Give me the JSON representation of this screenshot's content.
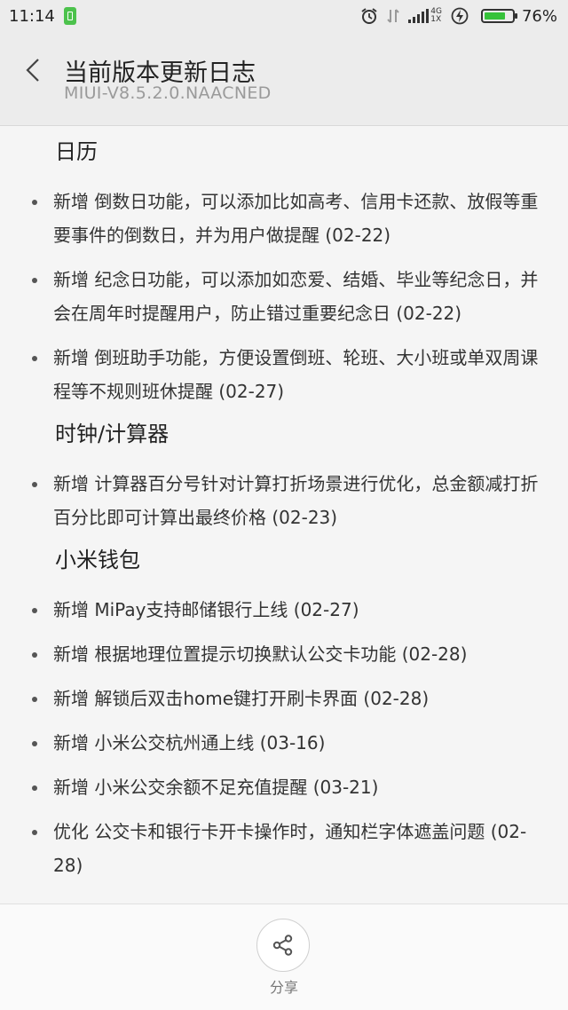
{
  "status_bar": {
    "time": "11:14",
    "net_gen": "4G",
    "net_sim": "1X",
    "battery_percent": 76,
    "battery_text": "76%",
    "accent_battery": "#36c23a"
  },
  "header": {
    "title": "当前版本更新日志",
    "subtitle": "MIUI-V8.5.2.0.NAACNED",
    "back_icon": "chevron-left-icon"
  },
  "sections": [
    {
      "title": "日历",
      "items": [
        "新增 倒数日功能，可以添加比如高考、信用卡还款、放假等重要事件的倒数日，并为用户做提醒 (02-22)",
        "新增 纪念日功能，可以添加如恋爱、结婚、毕业等纪念日，并会在周年时提醒用户，防止错过重要纪念日 (02-22)",
        "新增 倒班助手功能，方便设置倒班、轮班、大小班或单双周课程等不规则班休提醒 (02-27)"
      ]
    },
    {
      "title": "时钟/计算器",
      "items": [
        "新增 计算器百分号针对计算打折场景进行优化，总金额减打折百分比即可计算出最终价格 (02-23)"
      ]
    },
    {
      "title": "小米钱包",
      "items": [
        "新增 MiPay支持邮储银行上线 (02-27)",
        "新增 根据地理位置提示切换默认公交卡功能 (02-28)",
        "新增 解锁后双击home键打开刷卡界面 (02-28)",
        "新增 小米公交杭州通上线 (03-16)",
        "新增 小米公交余额不足充值提醒 (03-21)",
        "优化 公交卡和银行卡开卡操作时，通知栏字体遮盖问题 (02-28)"
      ]
    }
  ],
  "bottom_bar": {
    "share_label": "分享",
    "share_icon": "share-icon"
  }
}
